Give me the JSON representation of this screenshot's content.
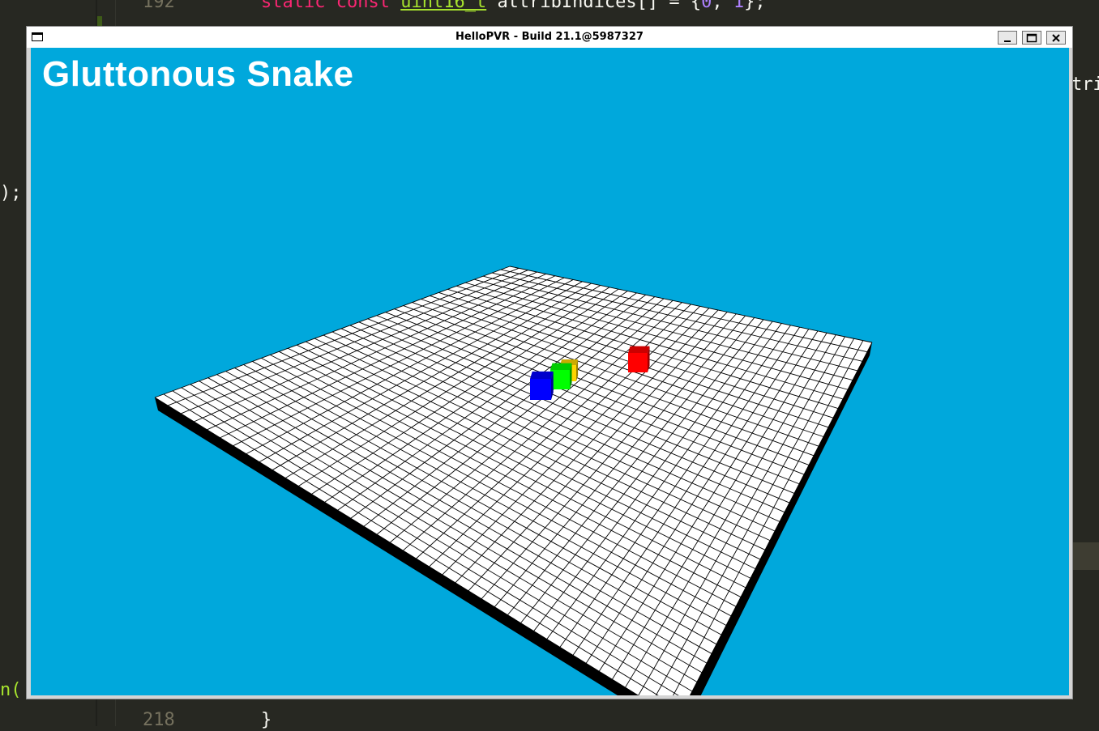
{
  "editor": {
    "line_numbers": [
      "192",
      "218"
    ],
    "line_192": {
      "kw1": "static",
      "kw2": "const",
      "type": "uint16_t",
      "ident": "attribIndices[] = {",
      "n0": "0",
      "sep": ", ",
      "n1": "1",
      "end": "};"
    },
    "left_fragment_1": ");",
    "left_fragment_2": "n(",
    "right_fragment": "tri",
    "line_218_code": "}"
  },
  "window": {
    "title": "HelloPVR - Build 21.1@5987327",
    "buttons": {
      "minimize_icon": "minimize-icon",
      "maximize_icon": "maximize-icon",
      "close_icon": "close-icon"
    }
  },
  "game": {
    "title": "Gluttonous Snake",
    "board": {
      "grid_columns": 40,
      "grid_rows": 40,
      "surface_color": "#ffffff",
      "grid_line_color": "#000000",
      "side_color": "#000000"
    },
    "background_color": "#00a8dc",
    "snake": [
      {
        "part": "head",
        "color": "#0000ff"
      },
      {
        "part": "body",
        "color": "#00ff00"
      },
      {
        "part": "tail",
        "color": "#ffd400"
      }
    ],
    "food": {
      "color": "#ff0000"
    }
  }
}
